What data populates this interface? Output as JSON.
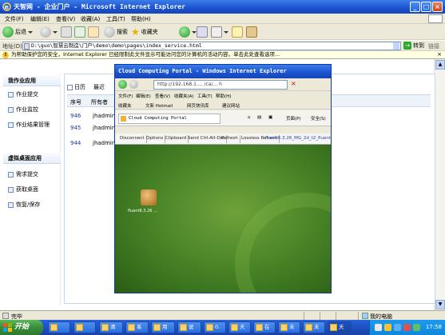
{
  "window": {
    "title": "天智网 - 企业门户 - Microsoft Internet Explorer",
    "buttons": [
      "minimize",
      "maximize",
      "close"
    ]
  },
  "menu": [
    "文件(F)",
    "编辑(E)",
    "查看(V)",
    "收藏(A)",
    "工具(T)",
    "帮助(H)"
  ],
  "toolbar": {
    "back": "后退",
    "search": "搜索",
    "favorites": "收藏夹"
  },
  "address": {
    "label": "地址(D)",
    "value": "D:\\guo\\智慧云制造\\门户\\demo\\demo\\pages\\index_service.html",
    "go": "转到",
    "links": "链接"
  },
  "infobar": {
    "text": "为帮助保护您的安全，Internet Explorer 已经限制此文件显示可能访问您的计算机的活动内容。单击此处查看选项..."
  },
  "sidebar": {
    "section1": "我作业应用",
    "items1": [
      "作业提交",
      "作业监控",
      "作业结果管理"
    ],
    "section2": "虚拟桌面应用",
    "items2": [
      "需求提交",
      "获取桌面",
      "恢复/保存"
    ]
  },
  "main": {
    "tabs": [
      "日历",
      "最近"
    ],
    "columns": [
      "序号",
      "所有者"
    ],
    "rows": [
      {
        "id": "946",
        "owner": "jhadmin"
      },
      {
        "id": "945",
        "owner": "jhadmin"
      },
      {
        "id": "944",
        "owner": "jhadmin"
      }
    ]
  },
  "status": {
    "left": "完毕",
    "zone": "我的电脑"
  },
  "taskbar": {
    "start": "开始",
    "tasks": [
      "",
      "",
      "清",
      "系",
      "用",
      "说",
      "0.",
      "天",
      "在",
      "未",
      "未",
      "天"
    ],
    "clock": "17:58"
  },
  "inner": {
    "title": "Cloud Computing Portal - Windows Internet Explorer",
    "address": "http://192.168.1.... /ca/... h",
    "menu": [
      "文件(F)",
      "编辑(E)",
      "查看(V)",
      "收藏夹(A)",
      "工具(T)",
      "帮助(H)"
    ],
    "fav": [
      "收藏夹",
      "文新 Hotmail",
      "网页快讯库",
      "建议网站"
    ],
    "tab": "Cloud Computing Portal",
    "tools": [
      "页面(P)",
      "安全(S)"
    ],
    "rdp_buttons": [
      "Disconnect",
      "Options",
      "Clipboard",
      "Send Ctrl-Alt-Del",
      "Refresh",
      "Lossless Refresh"
    ],
    "rdp_right": "fluent6.3.26_MG_2d_t2_fluent",
    "desktop_icon": "fluent6.3.26 ..."
  }
}
